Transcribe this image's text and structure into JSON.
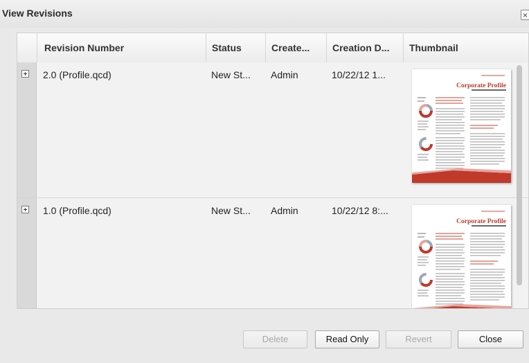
{
  "dialog": {
    "title": "View Revisions",
    "close_symbol": "×"
  },
  "columns": [
    "Revision Number",
    "Status",
    "Create...",
    "Creation D...",
    "Thumbnail"
  ],
  "rows": [
    {
      "revision": "2.0 (Profile.qcd)",
      "status": "New St...",
      "created_by": "Admin",
      "creation_date": "10/22/12 1..."
    },
    {
      "revision": "1.0 (Profile.qcd)",
      "status": "New St...",
      "created_by": "Admin",
      "creation_date": "10/22/12 8:..."
    }
  ],
  "thumbnail": {
    "heading": "Corporate Profile",
    "accent_color": "#c0392b"
  },
  "buttons": {
    "delete": "Delete",
    "read_only": "Read Only",
    "revert": "Revert",
    "close": "Close"
  }
}
